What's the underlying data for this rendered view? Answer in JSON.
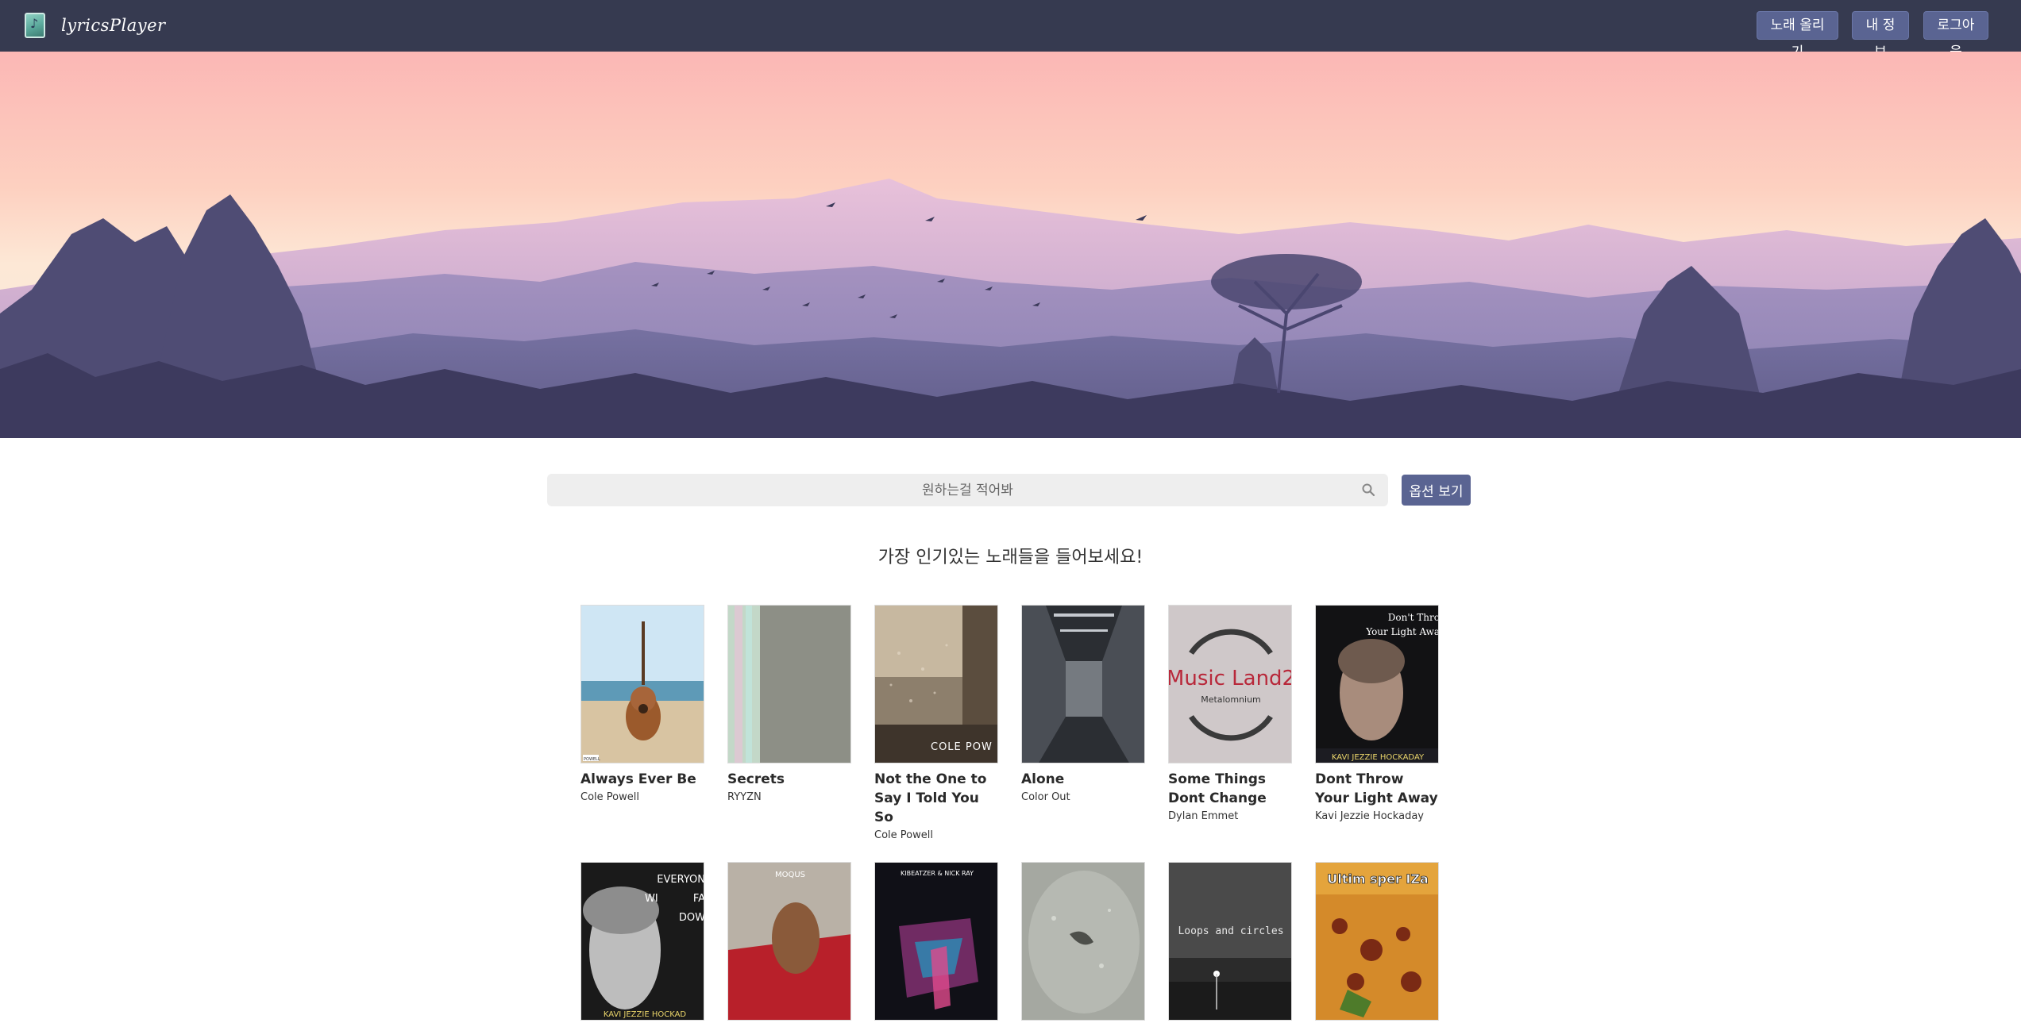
{
  "app": {
    "title": "lyricsPlayer"
  },
  "nav": {
    "upload_label": "노래 올리기",
    "myinfo_label": "내 정보",
    "logout_label": "로그아웃"
  },
  "search": {
    "placeholder": "원하는걸 적어봐",
    "options_label": "옵션 보기"
  },
  "section": {
    "popular_title": "가장 인기있는 노래들을 들어보세요!"
  },
  "songs": [
    {
      "title": "Always Ever Be",
      "artist": "Cole Powell",
      "cover_text": "POWELL"
    },
    {
      "title": "Secrets",
      "artist": "RYYZN",
      "cover_text": ""
    },
    {
      "title": "Not the One to Say I Told You So",
      "artist": "Cole Powell",
      "cover_text": "COLE POW"
    },
    {
      "title": "Alone",
      "artist": "Color Out",
      "cover_text": ""
    },
    {
      "title": "Some Things Dont Change",
      "artist": "Dylan Emmet",
      "cover_text": "Music Land2",
      "cover_subtext": "Metalomnium"
    },
    {
      "title": "Dont Throw Your Light Away",
      "artist": "Kavi Jezzie Hockaday",
      "cover_text": "Don't Thro Your Light Awa",
      "cover_subtext": "KAVI JEZZIE HOCKADAY"
    }
  ],
  "songs_row2": [
    {
      "cover_text": "EVERYON WI FA DOW",
      "cover_subtext": "KAVI JEZZIE HOCKAD"
    },
    {
      "cover_text": "MOQUS"
    },
    {
      "cover_text": "KIBEATZER & NICK RAY"
    },
    {
      "cover_text": ""
    },
    {
      "cover_text": "Loops and circles"
    },
    {
      "cover_text": "Ultim sper IZa"
    }
  ],
  "colors": {
    "navbar": "#363a50",
    "accent_button": "#5a6492",
    "search_bg": "#eeeeee"
  }
}
